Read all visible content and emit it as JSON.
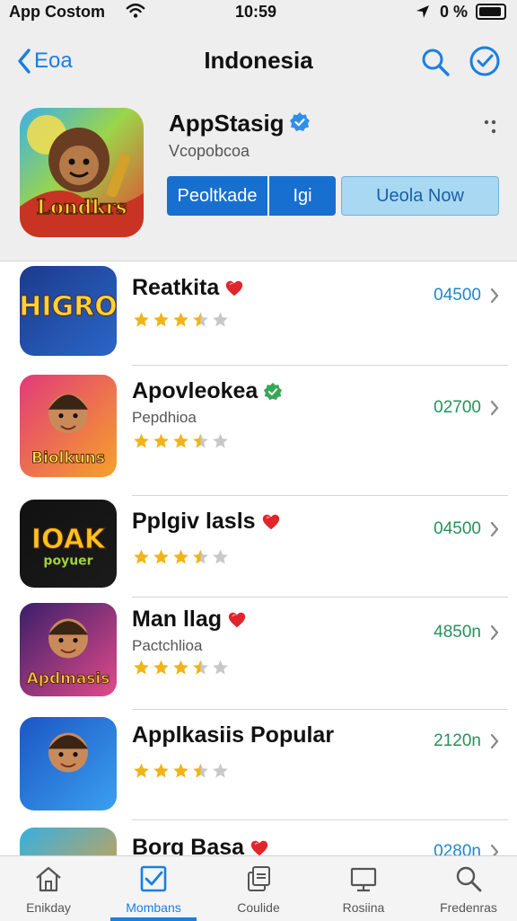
{
  "status_bar": {
    "carrier": "App Costom",
    "time": "10:59",
    "battery_text": "0 %"
  },
  "nav": {
    "back_label": "Eoa",
    "title": "Indonesia"
  },
  "featured": {
    "name": "AppStasig",
    "subtitle": "Vcopobcoa",
    "icon_text": "Londkrs",
    "primary_button": {
      "left": "Peoltkade",
      "right": "Igi"
    },
    "secondary_button": "Ueola Now"
  },
  "apps": [
    {
      "name": "Reatkita",
      "badge": "heart",
      "subtitle": "",
      "icon_text": "HIGRO",
      "rating": 3.5,
      "value": "04500",
      "value_color": "#1f86c8"
    },
    {
      "name": "Apovleokea",
      "badge": "verified",
      "subtitle": "Pepdhioa",
      "icon_text": "Biolkuns",
      "rating": 3.5,
      "value": "02700",
      "value_color": "#27915a"
    },
    {
      "name": "Pplgiv lasls",
      "badge": "heart",
      "subtitle": "",
      "icon_text": "IOAK",
      "icon_subtext": "poyuer",
      "rating": 3.5,
      "value": "04500",
      "value_color": "#27915a"
    },
    {
      "name": "Man llag",
      "badge": "heart",
      "subtitle": "Pactchlioa",
      "icon_text": "Apdmasis",
      "rating": 3.5,
      "value": "4850n",
      "value_color": "#27915a"
    },
    {
      "name": "Applkasiis  Popular",
      "badge": "",
      "subtitle": "",
      "icon_text": "",
      "rating": 3.5,
      "value": "2120n",
      "value_color": "#27915a"
    },
    {
      "name": "Borg Basa",
      "badge": "heart",
      "subtitle": "",
      "icon_text": "",
      "rating": 3.5,
      "value": "0280n",
      "value_color": "#1f86c8"
    }
  ],
  "tabs": [
    {
      "label": "Enikday",
      "icon": "home-icon",
      "active": false
    },
    {
      "label": "Mombans",
      "icon": "checkbox-icon",
      "active": true
    },
    {
      "label": "Coulide",
      "icon": "apps-icon",
      "active": false
    },
    {
      "label": "Rosiina",
      "icon": "monitor-icon",
      "active": false
    },
    {
      "label": "Fredenras",
      "icon": "search-icon",
      "active": false
    }
  ],
  "colors": {
    "accent": "#1a7fe0",
    "primary_button": "#1770d0",
    "secondary_button": "#a8d8f2",
    "heart": "#e0262c",
    "verified_blue": "#2f8fe8",
    "verified_green": "#35a853",
    "star": "#f0b418"
  }
}
